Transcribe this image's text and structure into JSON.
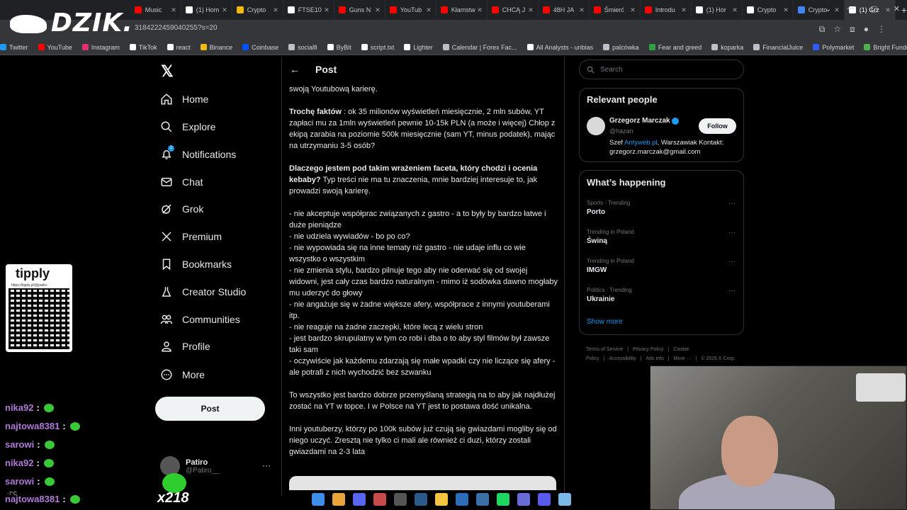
{
  "browser": {
    "tabs": [
      {
        "label": "Music",
        "color": "#ff0000"
      },
      {
        "label": "(1) Hom",
        "color": "#ffffff"
      },
      {
        "label": "Crypto",
        "color": "#f0b90b"
      },
      {
        "label": "FTSE10",
        "color": "#ffffff"
      },
      {
        "label": "Guns N",
        "color": "#ff0000"
      },
      {
        "label": "YouTub",
        "color": "#ff0000"
      },
      {
        "label": "Kłamstw",
        "color": "#ff0000"
      },
      {
        "label": "CHCĄ J",
        "color": "#ff0000"
      },
      {
        "label": "48H JA",
        "color": "#ff0000"
      },
      {
        "label": "Śmierć",
        "color": "#ff0000"
      },
      {
        "label": "Introdu",
        "color": "#ff0000"
      },
      {
        "label": "(1) Hor",
        "color": "#ffffff"
      },
      {
        "label": "Crypto",
        "color": "#ffffff"
      },
      {
        "label": "Crypto",
        "color": "#4285f4"
      },
      {
        "label": "(1) Grz",
        "color": "#ffffff",
        "active": true
      }
    ],
    "url": "31842224590402​55?s=20",
    "bookmarks": [
      {
        "label": "Twitter",
        "color": "#1d9bf0"
      },
      {
        "label": "YouTube",
        "color": "#ff0000"
      },
      {
        "label": "Instagram",
        "color": "#e1306c"
      },
      {
        "label": "TikTok",
        "color": "#ffffff"
      },
      {
        "label": "react",
        "color": "#ffffff"
      },
      {
        "label": "Binance",
        "color": "#f0b90b"
      },
      {
        "label": "Coinbase",
        "color": "#0052ff"
      },
      {
        "label": "socialfi",
        "color": "#bdc1c6"
      },
      {
        "label": "ByBit",
        "color": "#ffffff"
      },
      {
        "label": "script.txt",
        "color": "#ffffff"
      },
      {
        "label": "Lighter",
        "color": "#ffffff"
      },
      {
        "label": "Calendar | Forex Fac...",
        "color": "#bdc1c6"
      },
      {
        "label": "All Analysts - unbias",
        "color": "#ffffff"
      },
      {
        "label": "palcówka",
        "color": "#bdc1c6"
      },
      {
        "label": "Fear and greed",
        "color": "#2ea043"
      },
      {
        "label": "koparka",
        "color": "#bdc1c6"
      },
      {
        "label": "FinancialJuice",
        "color": "#bdc1c6"
      },
      {
        "label": "Polymarket",
        "color": "#2e5cff"
      },
      {
        "label": "Bright Funded",
        "color": "#4caf50"
      }
    ]
  },
  "overlay": {
    "logo": "DZIK.",
    "tipply_title": "tipply",
    "tipply_url": "https://tipply.pl/@patiro",
    "chat": [
      {
        "user": "nika92",
        "sep": ":"
      },
      {
        "user": "najtowa8381",
        "sep": ":"
      },
      {
        "user": "sarowi",
        "sep": ":"
      },
      {
        "user": "nika92",
        "sep": ":"
      },
      {
        "user": "sarowi",
        "sep": ":"
      },
      {
        "user": "najtowa8381",
        "sep": ":"
      }
    ],
    "combo": "x218"
  },
  "nav": {
    "items": [
      {
        "label": "Home",
        "icon": "home-icon"
      },
      {
        "label": "Explore",
        "icon": "search-icon"
      },
      {
        "label": "Notifications",
        "icon": "bell-icon"
      },
      {
        "label": "Chat",
        "icon": "mail-icon"
      },
      {
        "label": "Grok",
        "icon": "grok-icon"
      },
      {
        "label": "Premium",
        "icon": "x-icon"
      },
      {
        "label": "Bookmarks",
        "icon": "bookmark-icon"
      },
      {
        "label": "Creator Studio",
        "icon": "flask-icon"
      },
      {
        "label": "Communities",
        "icon": "people-icon"
      },
      {
        "label": "Profile",
        "icon": "person-icon"
      },
      {
        "label": "More",
        "icon": "more-circle-icon"
      }
    ],
    "notif_badge": "1",
    "post_button": "Post",
    "account": {
      "name": "Patiro",
      "handle": "@Patiro__"
    }
  },
  "main": {
    "title": "Post",
    "paragraphs": [
      {
        "bold": "",
        "text": "swoją Youtubową karierę."
      },
      {
        "bold": "Trochę faktów",
        "text": " : ok 35 milionów wyświetleń miesięcznie, 2 mln subów, YT zapłaci mu za 1mln wyświetleń pewnie 10-15k PLN (a może i więcej) Chłop z ekipą zarabia  na poziomie 500k miesięcznie (sam YT, minus podatek), mając na utrzymaniu 3-5 osób?"
      },
      {
        "bold": "Dlaczego jestem pod takim wrażeniem faceta, który chodzi i ocenia kebaby?",
        "text": " Typ treści nie ma tu znaczenia, mnie bardziej interesuje to, jak prowadzi swoją karierę."
      },
      {
        "bold": "",
        "text": "- nie akceptuje współprac związanych z gastro - a to były by bardzo łatwe i duże pieniądze\n- nie udziela wywiadów - bo po co?\n- nie wypowiada się na inne tematy niż gastro - nie udaje influ co wie wszystko o wszystkim\n- nie zmienia stylu, bardzo pilnuje tego aby nie oderwać się od swojej widowni, jest cały czas bardzo naturalnym - mimo iż sodówka dawno mogłaby mu uderzyć do głowy\n- nie angażuje się w żadne większe afery, współprace z innymi youtuberami itp.\n- nie reaguje na żadne zaczepki, które lecą z wielu stron\n- jest bardzo skrupulatny w tym co robi i dba o to aby styl filmów był zawsze taki sam\n- oczywiście jak każdemu zdarzają się małe wpadki czy nie liczące się afery - ale potrafi z nich wychodzić bez szwanku"
      },
      {
        "bold": "",
        "text": "To wszystko jest bardzo dobrze przemyślaną strategią na to aby jak najdłużej zostać na YT w topce. I w Polsce na YT jest to postawa dość unikalna."
      },
      {
        "bold": "",
        "text": "Inni youtuberzy, którzy po 100k subów już czują się gwiazdami mogliby się od niego uczyć. Zresztą nie tylko ci mali ale również ci duzi, którzy zostali gwiazdami na 2-3 lata"
      }
    ]
  },
  "sidebar": {
    "search_placeholder": "Search",
    "relevant_title": "Relevant people",
    "person": {
      "name": "Grzegorz Marczak",
      "handle": "@hazan",
      "follow": "Follow",
      "bio_pre": "Szef ",
      "bio_link": "Antyweb.pl",
      "bio_post": ", Warszawiak Kontakt: grzegorz.marczak@gmail.com"
    },
    "happening_title": "What’s happening",
    "trends": [
      {
        "context": "Sports · Trending",
        "title": "Porto"
      },
      {
        "context": "Trending in Poland",
        "title": "Świną"
      },
      {
        "context": "Trending in Poland",
        "title": "IMGW"
      },
      {
        "context": "Politics · Trending",
        "title": "Ukrainie"
      }
    ],
    "show_more": "Show more",
    "footer": [
      "Terms of Service",
      "|",
      "Privacy Policy",
      "|",
      "Cookie Policy",
      "|",
      "Accessibility",
      "|",
      "Ads info",
      "|",
      "More ···",
      "|",
      "© 2026 X Corp."
    ]
  },
  "taskbar": {
    "icons": [
      {
        "name": "windows-icon",
        "color": "#3d8ee6"
      },
      {
        "name": "chrome-icon",
        "color": "#e8a33a"
      },
      {
        "name": "discord-icon",
        "color": "#5865f2"
      },
      {
        "name": "app-icon",
        "color": "#c94a4a"
      },
      {
        "name": "obs-icon",
        "color": "#555555"
      },
      {
        "name": "steam-icon",
        "color": "#2a5a8a"
      },
      {
        "name": "explorer-icon",
        "color": "#f4c542"
      },
      {
        "name": "ccleaner-icon",
        "color": "#2c6fb8"
      },
      {
        "name": "tool-icon",
        "color": "#3b6fa8"
      },
      {
        "name": "spotify-icon",
        "color": "#1ed760"
      },
      {
        "name": "app2-icon",
        "color": "#6b6bd8"
      },
      {
        "name": "xapp-icon",
        "color": "#5a5af0"
      },
      {
        "name": "notepad-icon",
        "color": "#7ab8e8"
      }
    ],
    "tray": "-7°C"
  }
}
